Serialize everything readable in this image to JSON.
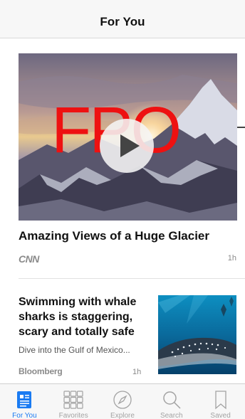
{
  "app": {
    "title": "For You"
  },
  "colors": {
    "accent": "#1a7bf2",
    "inactive_tab": "#a3a3a3",
    "fpo_red": "#ee1111",
    "background": "#ffffff",
    "bar": "#f7f7f7"
  },
  "feed": {
    "hero": {
      "image": "snowy-mountain-sunset-video-thumbnail",
      "placeholder_label": "FPO",
      "play_icon": "play-icon",
      "headline": "Amazing Views of a Huge Glacier",
      "source": "CNN",
      "time": "1h"
    },
    "article": {
      "headline": "Swimming with whale sharks is staggering, scary and totally safe",
      "summary": "Dive into the Gulf of Mexico...",
      "source": "Bloomberg",
      "time": "1h",
      "image": "whale-shark-underwater-photo"
    }
  },
  "tab_bar": {
    "tabs": [
      {
        "label": "For You",
        "icon": "for-you-icon",
        "active": true
      },
      {
        "label": "Favorites",
        "icon": "favorites-grid-icon",
        "active": false
      },
      {
        "label": "Explore",
        "icon": "compass-icon",
        "active": false
      },
      {
        "label": "Search",
        "icon": "search-icon",
        "active": false
      },
      {
        "label": "Saved",
        "icon": "bookmark-icon",
        "active": false
      }
    ]
  }
}
